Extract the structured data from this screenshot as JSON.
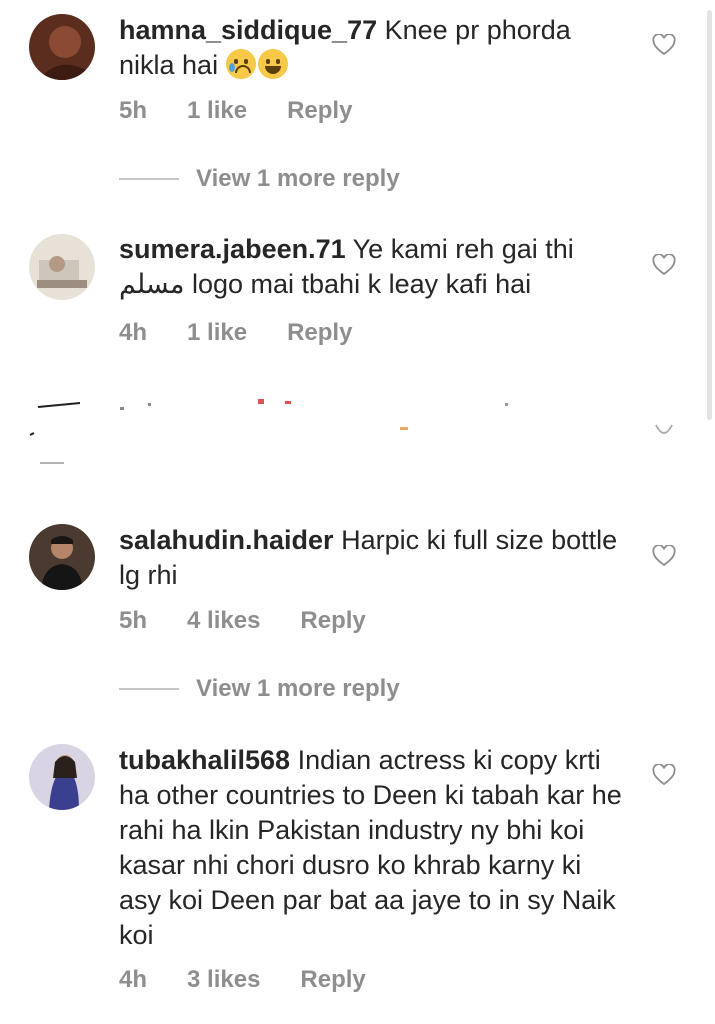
{
  "comments": [
    {
      "username": "hamna_siddique_77",
      "text": "Knee pr phorda nikla hai",
      "emoji": [
        "crying-face",
        "tears-of-joy"
      ],
      "time": "5h",
      "likes": "1 like",
      "reply": "Reply",
      "view_more": "View 1 more reply"
    },
    {
      "username": "sumera.jabeen.71",
      "text": "Ye kami reh gai thi مسلم logo mai tbahi k leay kafi hai",
      "time": "4h",
      "likes": "1 like",
      "reply": "Reply"
    },
    {
      "username": "salahudin.haider",
      "text": "Harpic ki full size bottle lg rhi",
      "time": "5h",
      "likes": "4 likes",
      "reply": "Reply",
      "view_more": "View 1 more reply"
    },
    {
      "username": "tubakhalil568",
      "text": "Indian actress ki copy krti ha other countries to Deen ki tabah kar he rahi ha lkin Pakistan industry ny bhi koi kasar nhi chori dusro ko khrab karny ki asy koi Deen par bat aa jaye to in sy Naik koi",
      "time": "4h",
      "likes": "3 likes",
      "reply": "Reply"
    }
  ],
  "colors": {
    "text": "#262626",
    "meta": "#8e8e8e",
    "divider": "#c7c7c7"
  },
  "icons": [
    "heart-outline-icon"
  ]
}
